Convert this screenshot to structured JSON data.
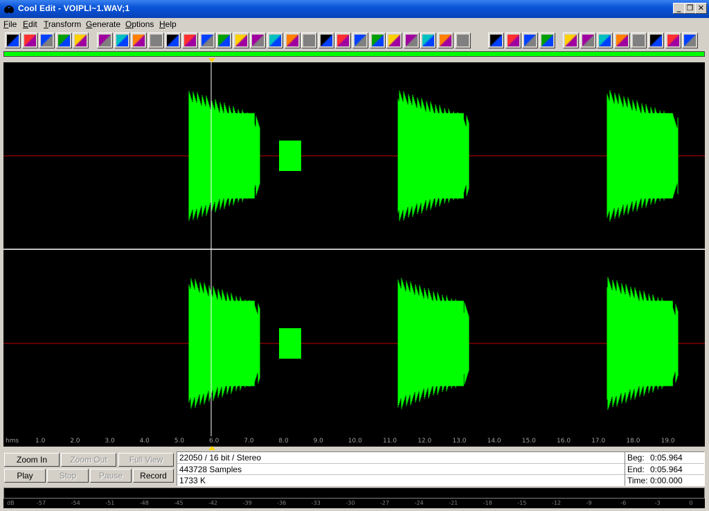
{
  "window": {
    "title": "Cool Edit - VOIPLI~1.WAV;1",
    "controls": [
      "_",
      "❐",
      "✕"
    ]
  },
  "menu": [
    "File",
    "Edit",
    "Transform",
    "Generate",
    "Options",
    "Help"
  ],
  "toolbar": {
    "group1": [
      "open-file",
      "open-folder",
      "save",
      "waveform-a",
      "waveform-b"
    ],
    "group2": [
      "paste",
      "rewind",
      "stop-bar",
      "reverse",
      "note",
      "circle",
      "grid-arrows",
      "stamp",
      "timer",
      "tiles",
      "echo",
      "filter",
      "triangle",
      "wave",
      "noise",
      "spectrum-a",
      "equalizer",
      "spectrum-b",
      "dots",
      "pattern",
      "rays",
      "flanger"
    ],
    "group3": [
      "dark-a",
      "dark-b",
      "dark-c",
      "dark-d"
    ],
    "group4": [
      "loop",
      "stripes",
      "grid",
      "magnifier",
      "cursor-i",
      "notes",
      "help",
      "globe"
    ]
  },
  "ruler": {
    "unit": "hms",
    "ticks": [
      "1.0",
      "2.0",
      "3.0",
      "4.0",
      "5.0",
      "6.0",
      "7.0",
      "8.0",
      "9.0",
      "10.0",
      "11.0",
      "12.0",
      "13.0",
      "14.0",
      "15.0",
      "16.0",
      "17.0",
      "18.0",
      "19.0"
    ]
  },
  "waveform": {
    "wave_color": "#00ff00",
    "center_line_color": "#c00000",
    "cursor_time": "0:05.964",
    "channels": [
      "left",
      "right"
    ]
  },
  "controls": {
    "zoom_in": "Zoom In",
    "zoom_out": "Zoom Out",
    "full_view": "Full View",
    "play": "Play",
    "stop": "Stop",
    "pause": "Pause",
    "record": "Record"
  },
  "status": {
    "format": "22050 / 16 bit / Stereo",
    "samples": "443728 Samples",
    "size": "1733 K",
    "beg_label": "Beg:",
    "beg_value": "0:05.964",
    "end_label": "End:",
    "end_value": "0:05.964",
    "time_label": "Time:",
    "time_value": "0:00.000"
  },
  "meter": {
    "unit": "dB",
    "ticks": [
      "-57",
      "-54",
      "-51",
      "-48",
      "-45",
      "-42",
      "-39",
      "-36",
      "-33",
      "-30",
      "-27",
      "-24",
      "-21",
      "-18",
      "-15",
      "-12",
      "-9",
      "-6",
      "-3",
      "0"
    ]
  }
}
